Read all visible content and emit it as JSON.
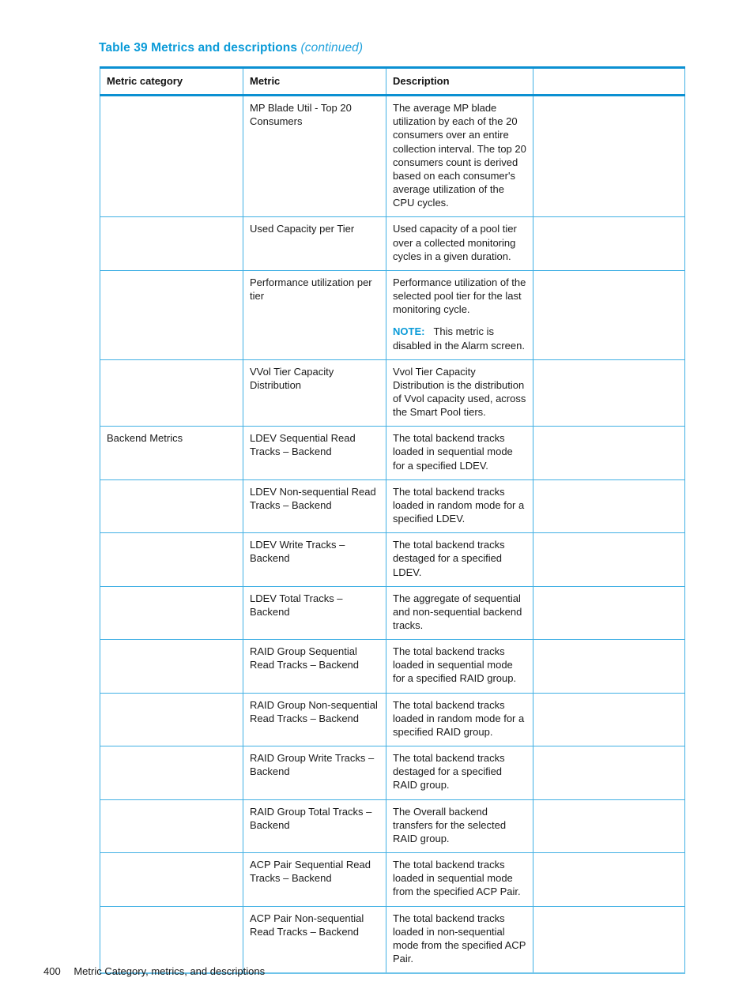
{
  "caption": {
    "main": "Table 39 Metrics and descriptions",
    "continued": "(continued)"
  },
  "table": {
    "headers": {
      "category": "Metric category",
      "metric": "Metric",
      "description": "Description",
      "blank": ""
    },
    "rows": [
      {
        "category": "",
        "metric": "MP Blade Util - Top 20 Consumers",
        "description": "The average MP blade utilization by each of the 20 consumers over an entire collection interval. The top 20 consumers count is derived based on each consumer's average utilization of the CPU cycles.",
        "blank": ""
      },
      {
        "category": "",
        "metric": "Used Capacity per Tier",
        "description": "Used capacity of a pool tier over a collected monitoring cycles in a given duration.",
        "blank": ""
      },
      {
        "category": "",
        "metric": "Performance utilization per tier",
        "description": "Performance utilization of the selected pool tier for the last monitoring cycle.",
        "note_label": "NOTE:",
        "note_text": "This metric is disabled in the Alarm screen.",
        "blank": ""
      },
      {
        "category": "",
        "metric": "VVol Tier Capacity Distribution",
        "description": "Vvol Tier Capacity Distribution is the distribution of Vvol capacity used, across the Smart Pool tiers.",
        "blank": ""
      },
      {
        "category": "Backend Metrics",
        "metric": "LDEV Sequential Read Tracks – Backend",
        "description": "The total backend tracks loaded in sequential mode for a specified LDEV.",
        "blank": ""
      },
      {
        "category": "",
        "metric": "LDEV Non-sequential Read Tracks – Backend",
        "description": "The total backend tracks loaded in random mode for a specified LDEV.",
        "blank": ""
      },
      {
        "category": "",
        "metric": "LDEV Write Tracks – Backend",
        "description": "The total backend tracks destaged for a specified LDEV.",
        "blank": ""
      },
      {
        "category": "",
        "metric": "LDEV Total Tracks – Backend",
        "description": "The aggregate of sequential and non-sequential backend tracks.",
        "blank": ""
      },
      {
        "category": "",
        "metric": "RAID Group Sequential Read Tracks – Backend",
        "description": "The total backend tracks loaded in sequential mode for a specified RAID group.",
        "blank": ""
      },
      {
        "category": "",
        "metric": "RAID Group Non-sequential Read Tracks – Backend",
        "description": "The total backend tracks loaded in random mode for a specified RAID group.",
        "blank": ""
      },
      {
        "category": "",
        "metric": "RAID Group Write Tracks – Backend",
        "description": "The total backend tracks destaged for a specified RAID group.",
        "blank": ""
      },
      {
        "category": "",
        "metric": "RAID Group Total Tracks – Backend",
        "description": "The Overall backend transfers for the selected RAID group.",
        "blank": ""
      },
      {
        "category": "",
        "metric": "ACP Pair Sequential Read Tracks – Backend",
        "description": "The total backend tracks loaded in sequential mode from the specified ACP Pair.",
        "blank": ""
      },
      {
        "category": "",
        "metric": "ACP Pair Non-sequential Read Tracks – Backend",
        "description": "The total backend tracks loaded in non-sequential mode from the specified ACP Pair.",
        "blank": ""
      }
    ]
  },
  "footer": {
    "page_number": "400",
    "running_head": "Metric Category, metrics, and descriptions"
  },
  "colors": {
    "accent_blue": "#0b9bd8",
    "rule_blue": "#41b0e4",
    "header_rule_blue": "#0b90d2",
    "text": "#1a1a1a"
  }
}
